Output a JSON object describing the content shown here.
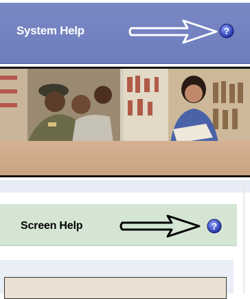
{
  "system_help": {
    "label": "System Help",
    "arrow_icon": "right-arrow-icon",
    "help_icon": "question-mark-icon"
  },
  "screen_help": {
    "label": "Screen Help",
    "arrow_icon": "right-arrow-icon",
    "help_icon": "question-mark-icon"
  },
  "colors": {
    "system_bar": "#7a88c4",
    "screen_bar": "#d4e6d3",
    "tan_strip": "#d2ad8c",
    "help_icon": "#2b3fb0"
  }
}
